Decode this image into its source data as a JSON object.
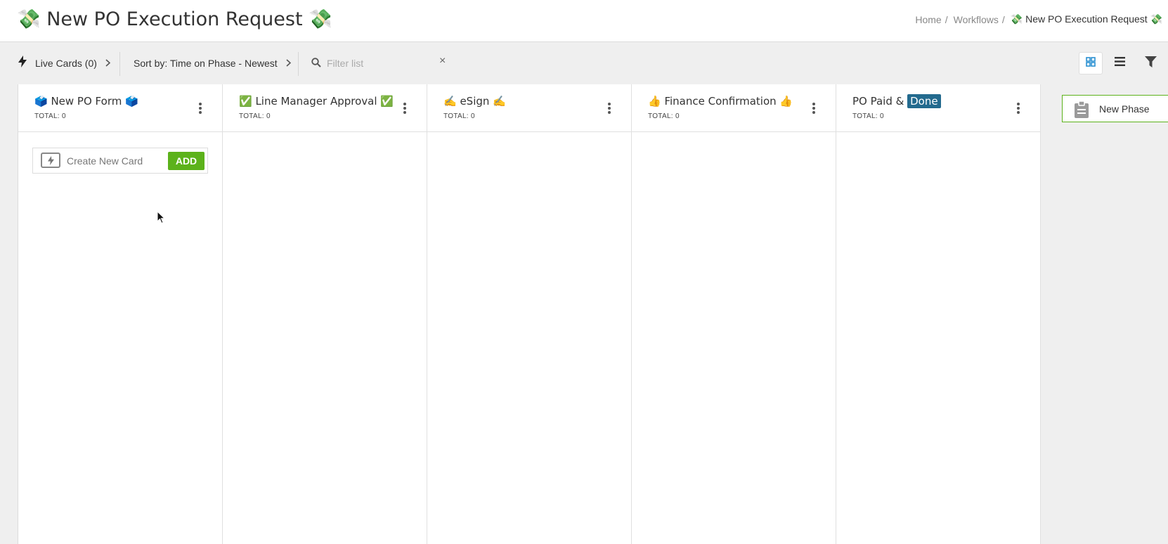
{
  "header": {
    "title": "💸 New PO Execution Request 💸",
    "breadcrumb": {
      "home": "Home",
      "workflows": "Workflows",
      "current": "💸 New PO Execution Request 💸"
    }
  },
  "toolbar": {
    "live_cards_label": "Live Cards (0)",
    "sort_label": "Sort by: Time on Phase - Newest",
    "filter_placeholder": "Filter list",
    "filter_value": "",
    "clear_icon": "×",
    "views": [
      "grid-view-icon",
      "list-view-icon",
      "filter-icon"
    ],
    "active_view": "grid-view-icon"
  },
  "columns": [
    {
      "title": "🗳️ New PO Form 🗳️",
      "total": "TOTAL: 0"
    },
    {
      "title": "✅ Line Manager Approval ✅",
      "total": "TOTAL: 0"
    },
    {
      "title": "✍️ eSign ✍️",
      "total": "TOTAL: 0"
    },
    {
      "title": "👍 Finance Confirmation 👍",
      "total": "TOTAL: 0"
    },
    {
      "title_prefix": "PO Paid & ",
      "title_highlight": "Done",
      "total": "TOTAL: 0"
    }
  ],
  "create_card": {
    "placeholder": "Create New Card",
    "add_label": "ADD"
  },
  "new_phase": {
    "label": "New Phase"
  },
  "colors": {
    "accent_green": "#5cb21b",
    "done_tag": "#236a8e",
    "active_view_icon": "#2a8fd1"
  }
}
